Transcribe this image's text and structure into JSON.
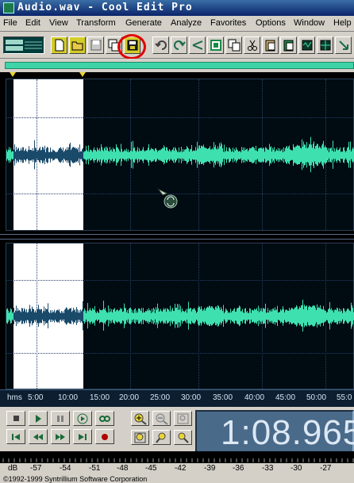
{
  "window": {
    "title": "Audio.wav - Cool Edit Pro"
  },
  "menu": [
    "File",
    "Edit",
    "View",
    "Transform",
    "Generate",
    "Analyze",
    "Favorites",
    "Options",
    "Window",
    "Help"
  ],
  "toolbar": {
    "buttons": [
      "new-file-icon",
      "open-file-icon",
      "save-icon",
      "save-as-icon",
      "save-selection-icon",
      "undo-icon",
      "repeat-last-command-icon",
      "cut-icon",
      "trim-icon",
      "copy-icon",
      "cut-scissors-icon",
      "paste-icon",
      "mix-paste-icon",
      "paste-new-icon",
      "grid-icon",
      "snap-icon"
    ],
    "highlighted": "save-selection-icon",
    "highlight_color": "#e00000"
  },
  "waveform": {
    "wave_color": "#3fe0b0",
    "selected_wave_color": "#1a4a6a",
    "selection_color": "#ffffff"
  },
  "ruler": {
    "unit": "hms",
    "ticks": [
      "5:00",
      "10:00",
      "15:00",
      "20:00",
      "25:00",
      "30:00",
      "35:00",
      "40:00",
      "45:00",
      "50:00",
      "55:0"
    ]
  },
  "transport": {
    "buttons": [
      "stop-icon",
      "play-icon",
      "pause-icon",
      "play-to-end-icon",
      "loop-icon",
      "go-to-start-icon",
      "rewind-icon",
      "fast-forward-icon",
      "go-to-end-icon",
      "record-icon"
    ],
    "zoom_buttons": [
      "zoom-in-horizontal-icon",
      "zoom-out-horizontal-icon",
      "zoom-full-icon",
      "zoom-selection-icon",
      "zoom-left-icon",
      "zoom-right-icon"
    ],
    "time": "1:08.965"
  },
  "meter": {
    "labels": [
      "dB",
      "-57",
      "-54",
      "-51",
      "-48",
      "-45",
      "-42",
      "-39",
      "-36",
      "-33",
      "-30",
      "-27"
    ]
  },
  "status": {
    "text": "©1992-1999 Syntrillium Software Corporation"
  }
}
